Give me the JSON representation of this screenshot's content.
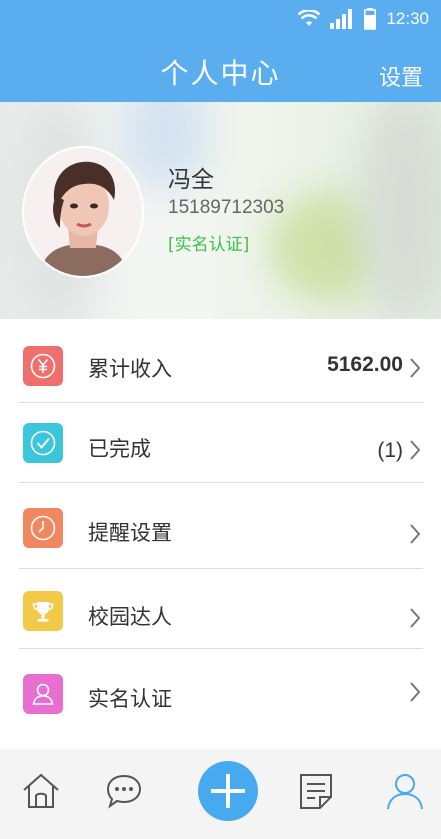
{
  "status_bar": {
    "time": "12:30"
  },
  "header": {
    "title": "个人中心",
    "settings": "设置"
  },
  "profile": {
    "name": "冯全",
    "phone": "15189712303",
    "verify": "[实名认证]"
  },
  "menu": {
    "items": [
      {
        "label": "累计收入",
        "value": "5162.00",
        "icon": "yen-icon",
        "color": "#ef6f6c"
      },
      {
        "label": "已完成",
        "value": "(1)",
        "icon": "checkmark-icon",
        "color": "#3cc6dc"
      },
      {
        "label": "提醒设置",
        "value": "",
        "icon": "clock-icon",
        "color": "#f0875e"
      },
      {
        "label": "校园达人",
        "value": "",
        "icon": "trophy-icon",
        "color": "#f3c94a"
      },
      {
        "label": "实名认证",
        "value": "",
        "icon": "person-icon",
        "color": "#e86fd1"
      }
    ]
  },
  "tabbar": {
    "items": [
      "home-icon",
      "message-icon",
      "add-icon",
      "task-list-icon",
      "profile-icon"
    ],
    "active": "profile-icon",
    "accent": "#47a9f0"
  }
}
